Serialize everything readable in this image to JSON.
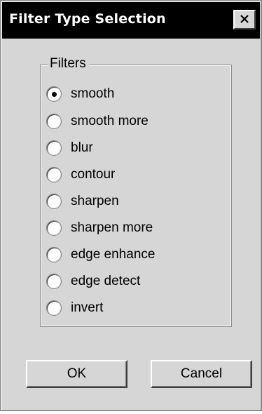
{
  "window": {
    "title": "Filter Type Selection",
    "close_label": "close"
  },
  "filters": {
    "legend": "Filters",
    "selected_index": 0,
    "options": [
      {
        "label": "smooth",
        "checked": true
      },
      {
        "label": "smooth more",
        "checked": false
      },
      {
        "label": "blur",
        "checked": false
      },
      {
        "label": "contour",
        "checked": false
      },
      {
        "label": "sharpen",
        "checked": false
      },
      {
        "label": "sharpen more",
        "checked": false
      },
      {
        "label": "edge enhance",
        "checked": false
      },
      {
        "label": "edge detect",
        "checked": false
      },
      {
        "label": "invert",
        "checked": false
      }
    ]
  },
  "buttons": {
    "ok_label": "OK",
    "cancel_label": "Cancel"
  },
  "colors": {
    "dialog_background": "#d6d6d6",
    "titlebar_background": "#000000",
    "titlebar_text": "#ffffff"
  }
}
